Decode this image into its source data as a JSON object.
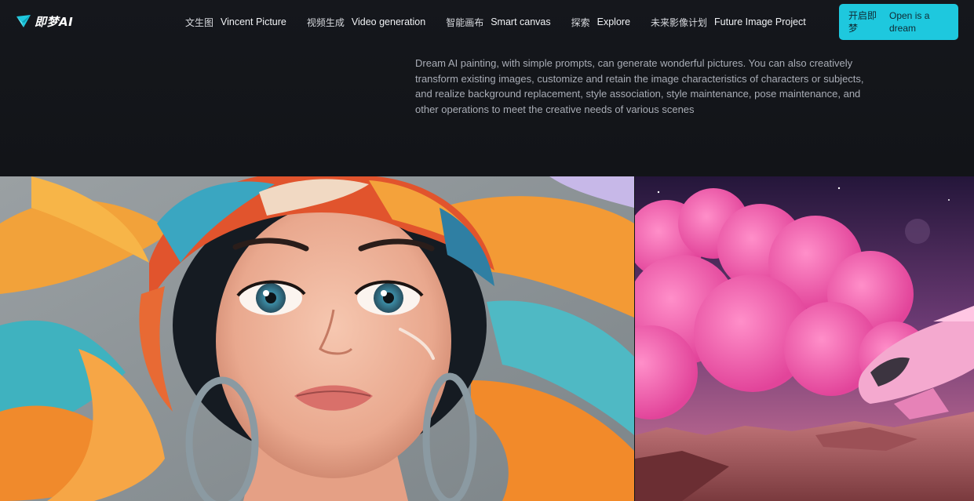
{
  "logo": {
    "text": "即梦AI",
    "icon": "paper-plane-logo-icon",
    "accent": "#1ec8de"
  },
  "nav": {
    "items": [
      {
        "zh": "文生图",
        "en": "Vincent Picture"
      },
      {
        "zh": "视频生成",
        "en": "Video generation"
      },
      {
        "zh": "智能画布",
        "en": "Smart canvas"
      },
      {
        "zh": "探索",
        "en": "Explore"
      },
      {
        "zh": "未来影像计划",
        "en": "Future Image Project"
      }
    ]
  },
  "cta": {
    "zh": "开启即梦",
    "en": "Open is a dream",
    "color": "#1ec8de"
  },
  "hero": {
    "description": "Dream AI painting, with simple prompts, can generate wonderful pictures. You can also creatively transform existing images, customize and retain the image characteristics of characters or subjects, and realize background replacement, style association, style maintenance, pose maintenance, and other operations to meet the creative needs of various scenes"
  },
  "gallery": {
    "left_image": "portrait-girl-with-colorful-headwrap",
    "right_image": "pink-clouds-spaceship-desert"
  },
  "colors": {
    "background": "#131519",
    "text_primary": "#f0f2f5",
    "text_secondary": "#a9adb6"
  }
}
